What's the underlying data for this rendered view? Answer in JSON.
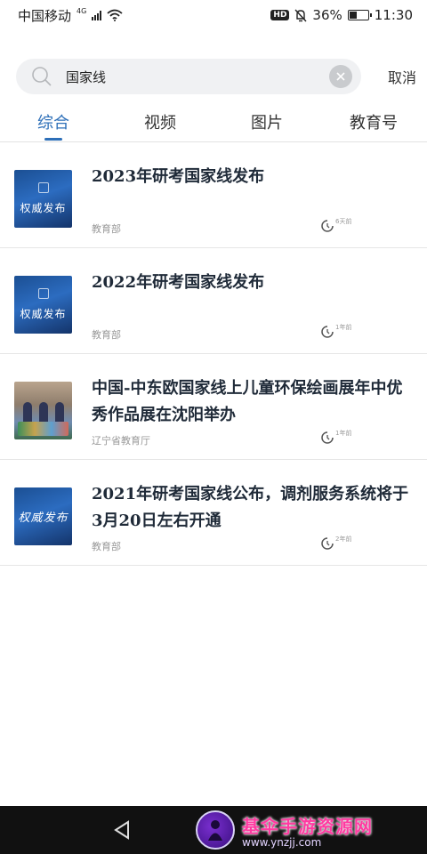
{
  "status_bar": {
    "carrier": "中国移动",
    "network": "4G",
    "battery": "36%",
    "battery_level": 0.36,
    "time": "11:30",
    "hd": "HD"
  },
  "search": {
    "query": "国家线",
    "cancel_label": "取消"
  },
  "tabs": [
    {
      "label": "综合",
      "active": true
    },
    {
      "label": "视频",
      "active": false
    },
    {
      "label": "图片",
      "active": false
    },
    {
      "label": "教育号",
      "active": false
    }
  ],
  "results": [
    {
      "title": "2023年研考国家线发布",
      "source": "教育部",
      "time": "6天前",
      "thumb_text": "权威发布"
    },
    {
      "title": "2022年研考国家线发布",
      "source": "教育部",
      "time": "1年前",
      "thumb_text": "权威发布"
    },
    {
      "title": "中国-中东欧国家线上儿童环保绘画展年中优秀作品展在沈阳举办",
      "source": "辽宁省教育厅",
      "time": "1年前",
      "thumb_text": ""
    },
    {
      "title": "2021年研考国家线公布，调剂服务系统将于3月20日左右开通",
      "source": "教育部",
      "time": "2年前",
      "thumb_text": "权威发布"
    }
  ],
  "watermark": {
    "title": "基伞手游资源网",
    "url": "www.ynzjj.com"
  },
  "colors": {
    "accent": "#2d6fb8",
    "title_text": "#1f2a38",
    "meta_text": "#999999",
    "search_bg": "#f0f1f3"
  }
}
